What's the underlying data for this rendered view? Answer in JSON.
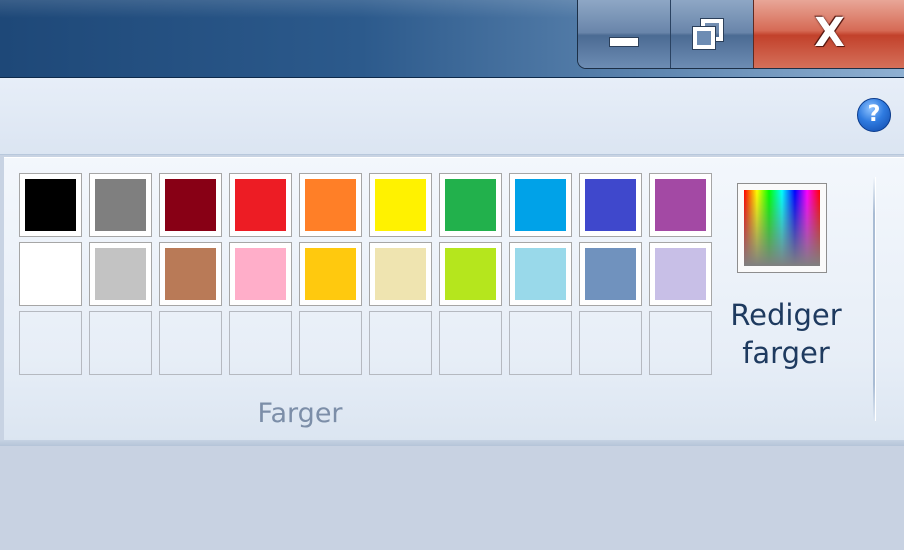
{
  "window": {
    "caption_buttons": {
      "minimize_icon": "minimize-icon",
      "maximize_icon": "restore-icon",
      "close_glyph": "X"
    }
  },
  "help": {
    "glyph": "?"
  },
  "colors_group": {
    "label": "Farger",
    "swatches_row1": [
      "#000000",
      "#7f7f7f",
      "#880015",
      "#ed1c24",
      "#ff7f27",
      "#fff200",
      "#22b14c",
      "#00a2e8",
      "#3f48cc",
      "#a349a4"
    ],
    "swatches_row2": [
      "#ffffff",
      "#c3c3c3",
      "#b97a57",
      "#ffaec9",
      "#ffc90e",
      "#efe4b0",
      "#b5e61d",
      "#99d9ea",
      "#7092be",
      "#c8bfe7"
    ],
    "custom_slots": 10,
    "edit_colors": {
      "line1": "Rediger",
      "line2": "farger",
      "icon": "color-spectrum-icon"
    }
  }
}
